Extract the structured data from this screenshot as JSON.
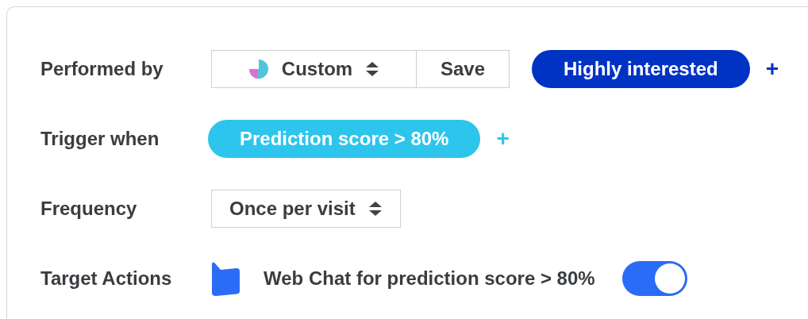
{
  "rows": [
    {
      "kind": "segment",
      "label": "Performed by",
      "select": {
        "value": "Custom"
      },
      "save": "Save",
      "chip": {
        "text": "Highly interested",
        "color": "#0033c4"
      },
      "add": "+"
    },
    {
      "kind": "chip",
      "label": "Trigger when",
      "chip": {
        "text": "Prediction score > 80%",
        "color": "#2ec5ec"
      },
      "add": "+"
    },
    {
      "kind": "select",
      "label": "Frequency",
      "select": {
        "value": "Once per visit"
      }
    },
    {
      "kind": "action",
      "label": "Target Actions",
      "action": "Web Chat for prediction score > 80%",
      "on": true
    }
  ]
}
